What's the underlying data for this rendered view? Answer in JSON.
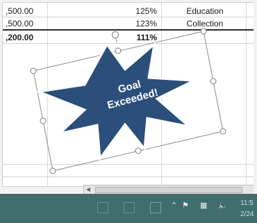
{
  "table": {
    "rows": [
      {
        "amount": ",500.00",
        "percent": "125%",
        "category": "Education"
      },
      {
        "amount": ",500.00",
        "percent": "123%",
        "category": "Collection"
      },
      {
        "amount": ",200.00",
        "percent": "111%",
        "category": ""
      }
    ]
  },
  "shape": {
    "line1": "Goal",
    "line2": "Exceeded!",
    "fill_color": "#2b4f7a",
    "outline_color": "#ffffff",
    "handle_icon": "rotate-handle-icon"
  },
  "taskbar": {
    "clock_time": "11:5",
    "clock_date": "2/24",
    "icons": [
      "start-grid-icon",
      "task-view-icon",
      "window-icon",
      "chevron-up-icon",
      "flag-icon",
      "network-icon",
      "speaker-icon"
    ]
  }
}
